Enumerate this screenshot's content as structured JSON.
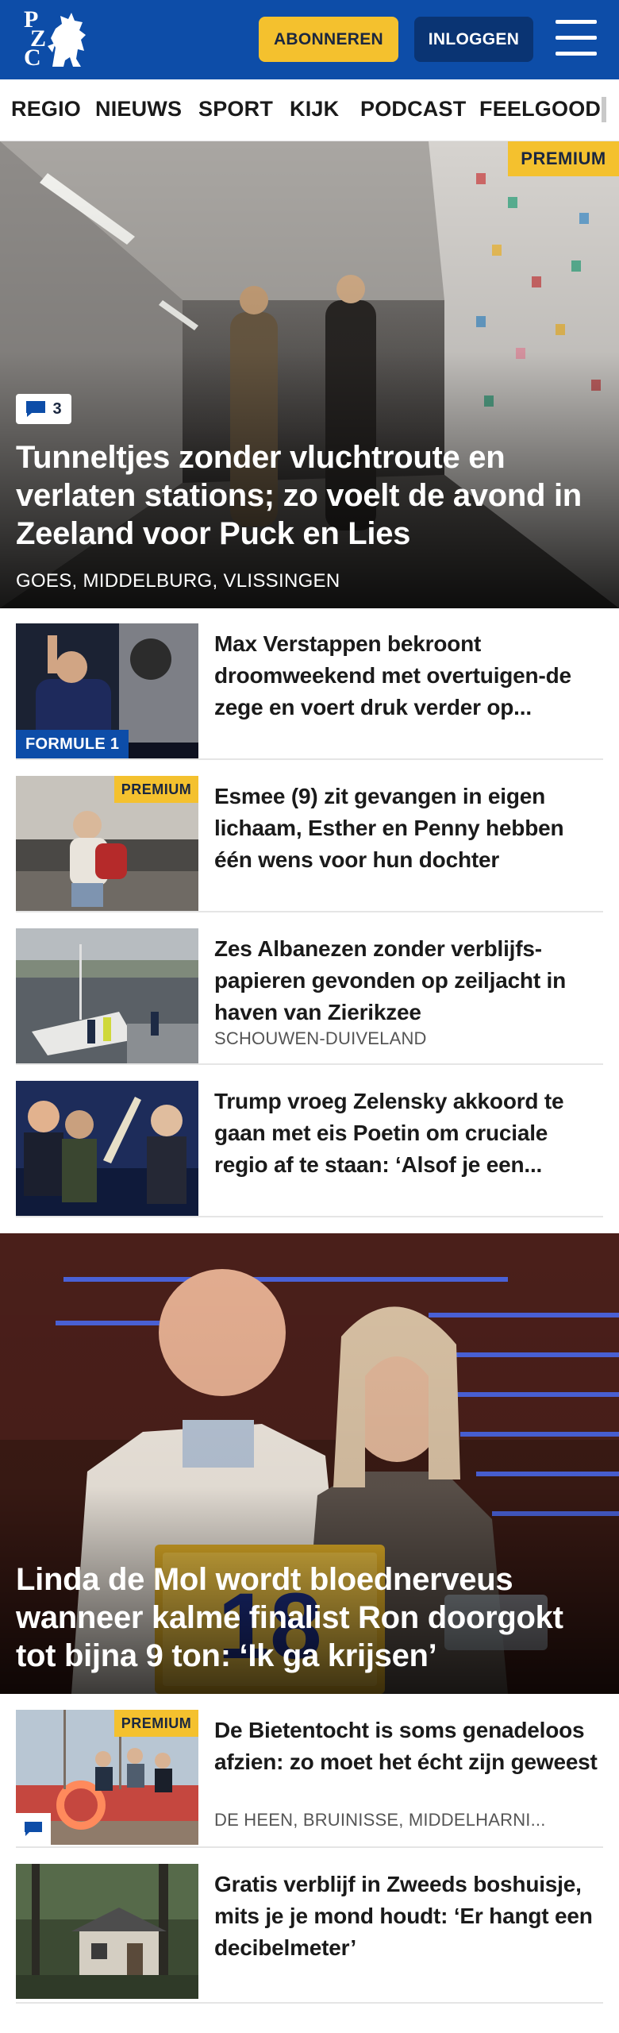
{
  "header": {
    "logo_letters": [
      "P",
      "Z",
      "C"
    ],
    "subscribe_label": "ABONNEREN",
    "login_label": "INLOGGEN",
    "menu_icon": "hamburger-icon",
    "colors": {
      "brand_blue": "#0d4da8",
      "accent_yellow": "#f4c12e",
      "login_dark": "#0a3473"
    }
  },
  "nav": {
    "items": [
      "REGIO",
      "NIEUWS",
      "SPORT",
      "KIJK",
      "PODCAST",
      "FEELGOOD"
    ]
  },
  "hero": {
    "badge": "PREMIUM",
    "comment_count": "3",
    "title": "Tunneltjes zonder vluchtroute en verlaten stations; zo voelt de avond in Zeeland voor Puck en Lies",
    "location": "GOES, MIDDELBURG, VLISSINGEN"
  },
  "articles": [
    {
      "title": "Max Verstappen bekroont droomweekend met overtuigen-de zege en voert druk verder op...",
      "category": "FORMULE 1"
    },
    {
      "title": "Esmee (9) zit gevangen in eigen lichaam, Esther en Penny hebben één wens voor hun dochter",
      "badge": "PREMIUM"
    },
    {
      "title": "Zes Albanezen zonder verblijfs-papieren gevonden op zeiljacht in haven van Zierikzee",
      "location": "SCHOUWEN-DUIVELAND"
    },
    {
      "title": "Trump vroeg Zelensky akkoord te gaan met eis Poetin om cruciale regio af te staan: ‘Alsof je een..."
    }
  ],
  "feature": {
    "podium_number": "18",
    "title": "Linda de Mol wordt bloednerveus wanneer kalme finalist Ron doorgokt tot bijna 9 ton: ‘Ik ga krijsen’"
  },
  "articles_after": [
    {
      "title": "De Bietentocht is soms genadeloos afzien: zo moet het écht zijn geweest",
      "badge": "PREMIUM",
      "location": "DE HEEN, BRUINISSE, MIDDELHARNI...",
      "has_comment_icon": true
    },
    {
      "title": "Gratis verblijf in Zweeds boshuisje, mits je je mond houdt: ‘Er hangt een decibelmeter’"
    }
  ]
}
